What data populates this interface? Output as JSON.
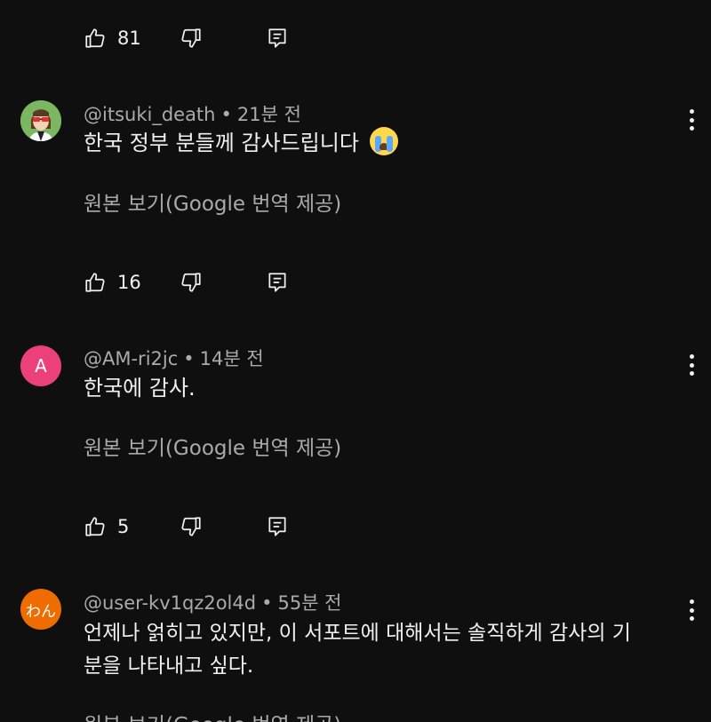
{
  "icons": {
    "like": "thumb-up-icon",
    "dislike": "thumb-down-icon",
    "reply": "reply-icon",
    "more": "more-vert-icon"
  },
  "top_actions": {
    "like_count": "81"
  },
  "comments": [
    {
      "author": "@itsuki_death",
      "separator": "•",
      "time": "21분 전",
      "text": "한국 정부 분들께 감사드립니다",
      "emoji": "loudly-crying-face",
      "translate_label": "원본 보기(Google 번역 제공)",
      "like_count": "16",
      "avatar_color": "#7bb661"
    },
    {
      "author": "@AM-ri2jc",
      "separator": "•",
      "time": "14분 전",
      "text": "한국에 감사.",
      "translate_label": "원본 보기(Google 번역 제공)",
      "like_count": "5",
      "avatar_letter": "A",
      "avatar_color": "#ec407a"
    },
    {
      "author": "@user-kv1qz2ol4d",
      "separator": "•",
      "time": "55분 전",
      "text_line1": "언제나 얽히고 있지만, 이 서포트에 대해서는 솔직하게 감사의 기",
      "text_line2": "분을 나타내고 싶다.",
      "translate_label": "원본 보기(Google 번역 제공)",
      "avatar_letter": "わん",
      "avatar_color": "#ef6c00"
    }
  ]
}
